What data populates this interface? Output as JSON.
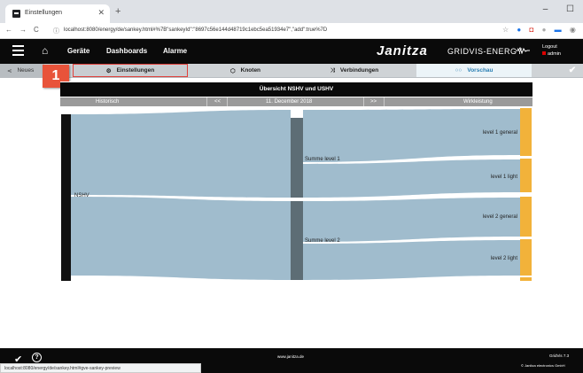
{
  "browser": {
    "tab_title": "Einstellungen",
    "url": "localhost:8080/energy/de/sankey.html#%7B\"sankeyId\":\"8697c56e144d48719c1ebc5ea51934e7\",\"add\":true%7D",
    "status_url": "localhost:8080/energy/de/sankey.html#gve-sankey-preview"
  },
  "header": {
    "menu": [
      "Geräte",
      "Dashboards",
      "Alarme"
    ],
    "brand": "Janitza",
    "product": "GRIDVIS-ENERGY",
    "logout_label": "Logout",
    "user": "admin"
  },
  "toolbar": {
    "neues": "Neues",
    "einstellungen": "Einstellungen",
    "knoten": "Knoten",
    "verbindungen": "Verbindungen",
    "vorschau": "Vorschau",
    "step_number": "1"
  },
  "panel": {
    "title": "Übersicht NSHV und USHV",
    "left_label": "Historisch",
    "prev": "<<",
    "date": "11. December 2018",
    "next": ">>",
    "right_label": "Wirkleistung"
  },
  "sankey": {
    "nodes": [
      "NSHV",
      "Summe level 1",
      "Summe level 2",
      "level 1 general",
      "level 1 light",
      "level 2 general",
      "level 2 light"
    ],
    "colors": {
      "source": "#111111",
      "middle": "#5d6d75",
      "sink": "#f2b23a",
      "link": "#8fb0c4"
    }
  },
  "footer": {
    "website": "www.janitza.de",
    "version": "GridVis 7.3",
    "copyright": "© Janitza electronics GmbH"
  }
}
